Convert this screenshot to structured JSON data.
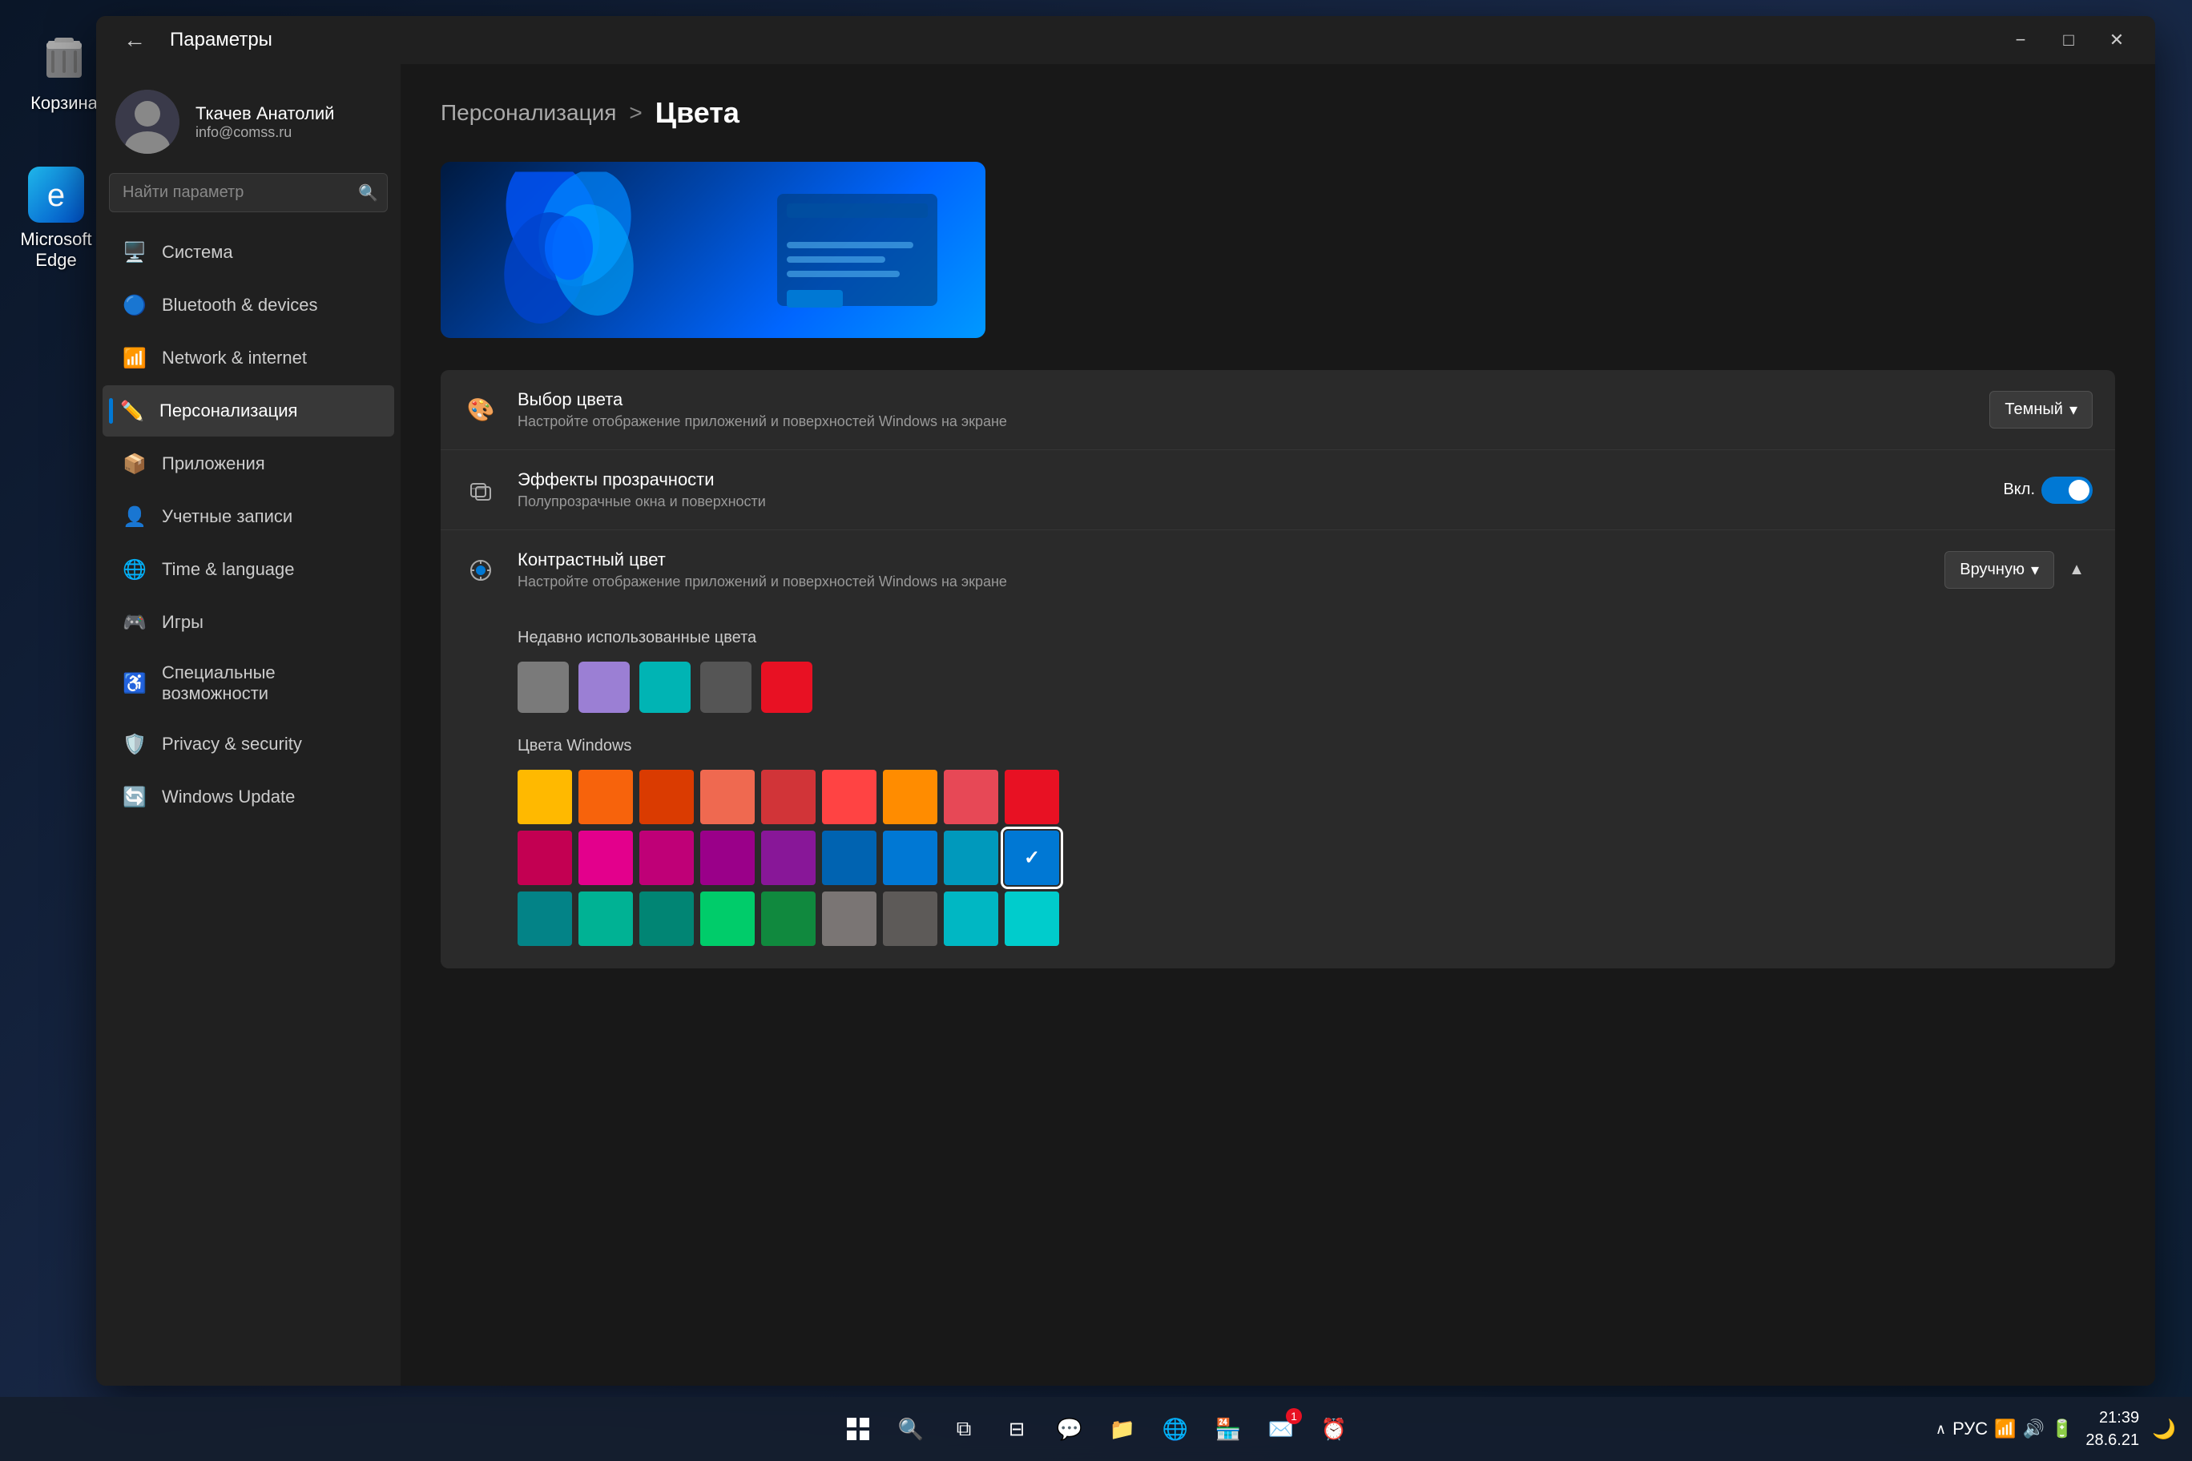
{
  "desktop": {
    "icons": [
      {
        "id": "trash",
        "label": "Корзина",
        "symbol": "🗑️"
      },
      {
        "id": "edge",
        "label": "Microsoft Edge",
        "symbol": "🌐"
      }
    ]
  },
  "taskbar": {
    "time": "21:39",
    "date": "28.6.21",
    "lang": "РУС",
    "center_icons": [
      {
        "id": "start",
        "symbol": "⊞"
      },
      {
        "id": "search",
        "symbol": "🔍"
      },
      {
        "id": "taskview",
        "symbol": "⧉"
      },
      {
        "id": "widgets",
        "symbol": "⊟"
      },
      {
        "id": "chat",
        "symbol": "💬"
      },
      {
        "id": "explorer",
        "symbol": "📁"
      },
      {
        "id": "edge-task",
        "symbol": "🌐"
      },
      {
        "id": "store",
        "symbol": "🏪"
      },
      {
        "id": "mail",
        "symbol": "✉️"
      },
      {
        "id": "clock",
        "symbol": "⏰"
      }
    ]
  },
  "window": {
    "title": "Параметры",
    "back_label": "←"
  },
  "user": {
    "name": "Ткачев Анатолий",
    "email": "info@comss.ru"
  },
  "search": {
    "placeholder": "Найти параметр"
  },
  "nav": {
    "items": [
      {
        "id": "system",
        "label": "Система",
        "icon": "🖥️",
        "active": false
      },
      {
        "id": "bluetooth",
        "label": "Bluetooth & devices",
        "icon": "🔵",
        "active": false
      },
      {
        "id": "network",
        "label": "Network & internet",
        "icon": "📶",
        "active": false
      },
      {
        "id": "personalization",
        "label": "Персонализация",
        "icon": "✏️",
        "active": true
      },
      {
        "id": "apps",
        "label": "Приложения",
        "icon": "📦",
        "active": false
      },
      {
        "id": "accounts",
        "label": "Учетные записи",
        "icon": "👤",
        "active": false
      },
      {
        "id": "time",
        "label": "Time & language",
        "icon": "🌐",
        "active": false
      },
      {
        "id": "gaming",
        "label": "Игры",
        "icon": "🎮",
        "active": false
      },
      {
        "id": "accessibility",
        "label": "Специальные возможности",
        "icon": "♿",
        "active": false
      },
      {
        "id": "privacy",
        "label": "Privacy & security",
        "icon": "🛡️",
        "active": false
      },
      {
        "id": "update",
        "label": "Windows Update",
        "icon": "🔄",
        "active": false
      }
    ]
  },
  "main": {
    "breadcrumb_parent": "Персонализация",
    "breadcrumb_separator": ">",
    "breadcrumb_current": "Цвета",
    "settings": [
      {
        "id": "color-choice",
        "icon": "🎨",
        "title": "Выбор цвета",
        "desc": "Настройте отображение приложений и поверхностей Windows на экране",
        "control_type": "dropdown",
        "control_value": "Темный",
        "expanded": false
      },
      {
        "id": "transparency",
        "icon": "✨",
        "title": "Эффекты прозрачности",
        "desc": "Полупрозрачные окна и поверхности",
        "control_type": "toggle",
        "control_value": "Вкл.",
        "toggled": true,
        "expanded": false
      },
      {
        "id": "accent-color",
        "icon": "🎯",
        "title": "Контрастный цвет",
        "desc": "Настройте отображение приложений и поверхностей Windows на экране",
        "control_type": "dropdown",
        "control_value": "Вручную",
        "expanded": true
      }
    ],
    "recent_colors_label": "Недавно использованные цвета",
    "recent_colors": [
      "#7a7a7a",
      "#9b7fd4",
      "#00b4b4",
      "#555555",
      "#e81123"
    ],
    "windows_colors_label": "Цвета Windows",
    "windows_colors_row1": [
      "#FFB900",
      "#F7630C",
      "#E74856",
      "#E74856",
      "#FF4343",
      "#FF8C00",
      "#E3008C",
      "#E81123",
      "#B146C2"
    ],
    "windows_colors_row2": [
      "#C30052",
      "#E3008C",
      "#BF0077",
      "#9A0089",
      "#881798",
      "#0063B1",
      "#0078D4",
      "#0099BC",
      "#00B7C3"
    ],
    "windows_colors_row3_partial": [
      "#038387",
      "#00B294",
      "#018574",
      "#00CC6A",
      "#10893E",
      "#7A7574",
      "#5D5A58",
      "#68768A",
      "#515C6B"
    ],
    "selected_color": "#0078D4",
    "colors_grid": {
      "row1": [
        "#FFB900",
        "#F7630C",
        "#DA3B01",
        "#EF6950",
        "#D13438",
        "#FF4343",
        "#FF8C00",
        "#F7630C",
        "#E74856"
      ],
      "row2": [
        "#C30052",
        "#E3008C",
        "#BF0077",
        "#9A0089",
        "#881798",
        "#0063B1",
        "#0078D4",
        "#0099BC",
        "#00B7C3"
      ],
      "row3": [
        "#038387",
        "#00B294",
        "#018574",
        "#00CC6A",
        "#10893E",
        "#7A7574",
        "#5D5A58",
        "#68768A",
        "#515C6B"
      ]
    }
  }
}
